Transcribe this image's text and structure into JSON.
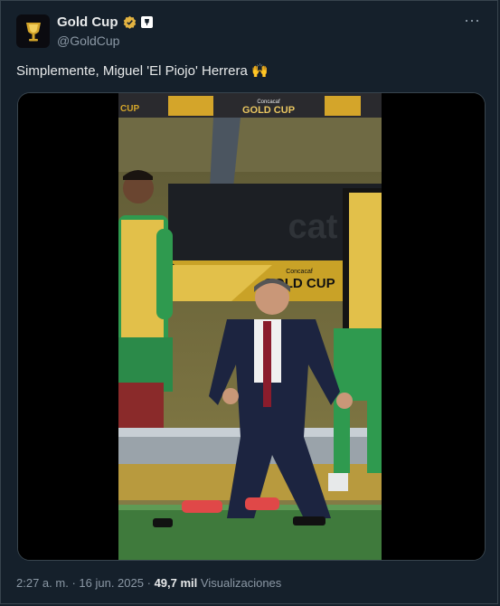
{
  "author": {
    "display_name": "Gold Cup",
    "handle": "@GoldCup"
  },
  "tweet": {
    "text": "Simplemente, Miguel 'El Piojo' Herrera",
    "emoji": "🙌"
  },
  "video": {
    "banner_top": "GOLD CUP",
    "banner_top_small": "Concacaf",
    "banner_top_left": "CUP",
    "board_text": "GOLD CUP",
    "board_small": "Concacaf"
  },
  "meta": {
    "time": "2:27 a. m.",
    "separator": "·",
    "date": "16 jun. 2025",
    "views_count": "49,7 mil",
    "views_label": "Visualizaciones"
  },
  "colors": {
    "background": "#15202b",
    "gold": "#d4a52a",
    "verified": "#e3b341"
  }
}
